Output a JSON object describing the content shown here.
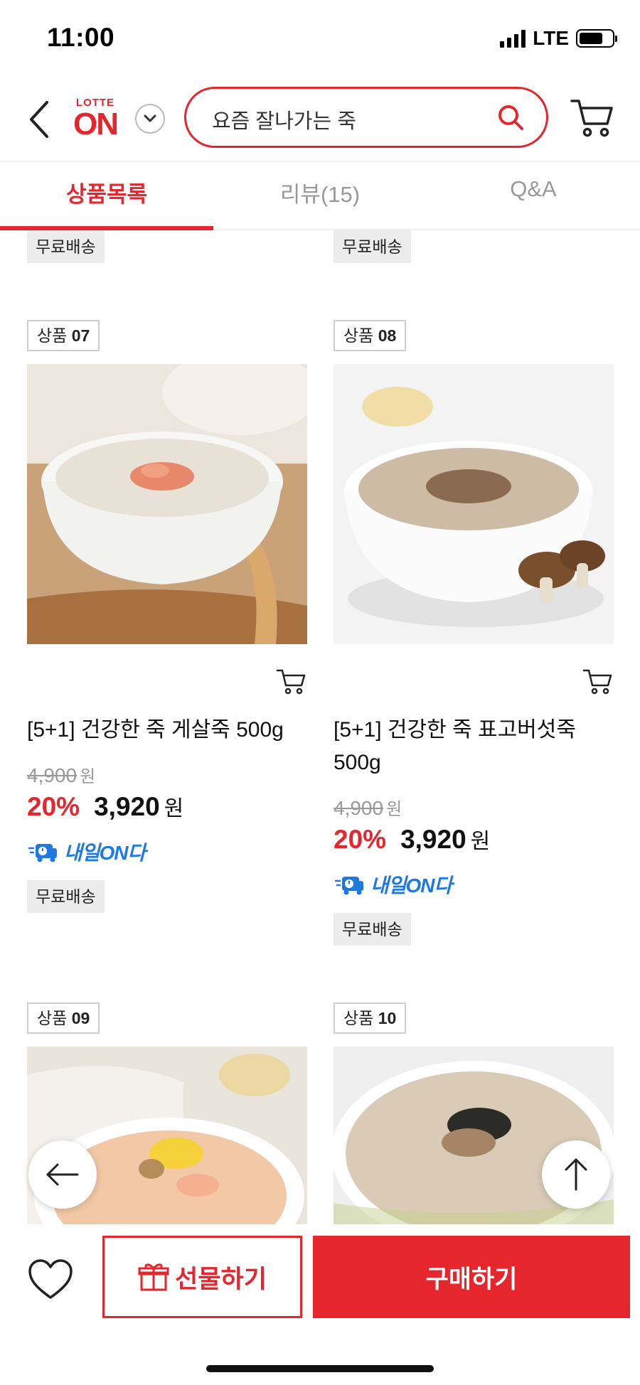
{
  "status": {
    "time": "11:00",
    "network": "LTE"
  },
  "header": {
    "logo_top": "LOTTE",
    "logo_main": "ON",
    "search_query": "요즘 잘나가는 죽"
  },
  "tabs": [
    {
      "label": "상품목록"
    },
    {
      "label": "리뷰(15)"
    },
    {
      "label": "Q&A"
    }
  ],
  "top_tags": [
    "무료배송",
    "무료배송"
  ],
  "products": [
    {
      "label": "상품",
      "num": "07",
      "title": "[5+1] 건강한 죽 게살죽 500g",
      "original_price": "4,900",
      "original_won": "원",
      "discount": "20%",
      "price": "3,920",
      "won": "원",
      "delivery": "내일ON다",
      "shipping": "무료배송"
    },
    {
      "label": "상품",
      "num": "08",
      "title": "[5+1] 건강한 죽 표고버섯죽 500g",
      "original_price": "4,900",
      "original_won": "원",
      "discount": "20%",
      "price": "3,920",
      "won": "원",
      "delivery": "내일ON다",
      "shipping": "무료배송"
    },
    {
      "label": "상품",
      "num": "09"
    },
    {
      "label": "상품",
      "num": "10"
    }
  ],
  "bottom": {
    "gift_label": "선물하기",
    "buy_label": "구매하기"
  }
}
